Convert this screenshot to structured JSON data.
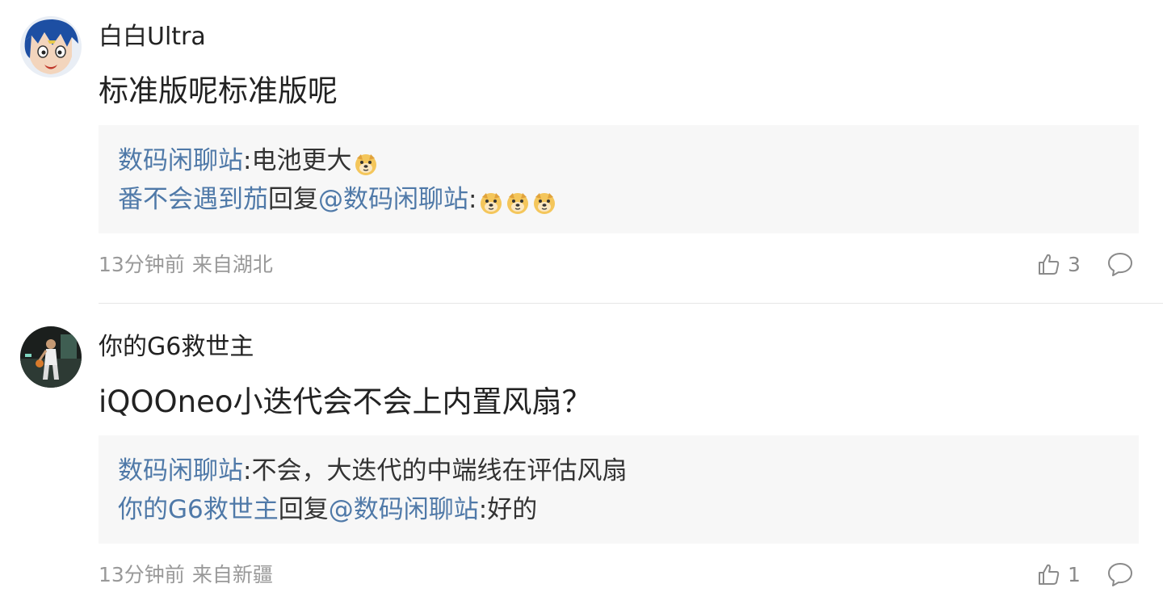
{
  "colors": {
    "link": "#4f79a8",
    "meta": "#999999",
    "reply_bg": "#f7f7f7",
    "text": "#222222"
  },
  "comments": [
    {
      "avatar": "avatar-anime-blue-hair",
      "username": "白白Ultra",
      "content": "标准版呢标准版呢",
      "replies": [
        {
          "author": "数码闲聊站",
          "reply_to": "",
          "text": ":电池更大",
          "emoji_count": 1
        },
        {
          "author": "番不会遇到茄",
          "reply_to_prefix": "回复",
          "reply_to": "@数码闲聊站",
          "text": ":",
          "emoji_count": 3
        }
      ],
      "time": "13分钟前",
      "location": "来自湖北",
      "likes": "3",
      "like_icon": "thumbs-up-icon",
      "reply_icon": "comment-bubble-icon"
    },
    {
      "avatar": "avatar-basketball-player",
      "username": "你的G6救世主",
      "content": "iQOOneo小迭代会不会上内置风扇？",
      "replies": [
        {
          "author": "数码闲聊站",
          "reply_to": "",
          "text": ":不会，大迭代的中端线在评估风扇",
          "emoji_count": 0
        },
        {
          "author": "你的G6救世主",
          "reply_to_prefix": "回复",
          "reply_to": "@数码闲聊站",
          "text": ":好的",
          "emoji_count": 0
        }
      ],
      "time": "13分钟前",
      "location": "来自新疆",
      "likes": "1",
      "like_icon": "thumbs-up-icon",
      "reply_icon": "comment-bubble-icon"
    }
  ]
}
